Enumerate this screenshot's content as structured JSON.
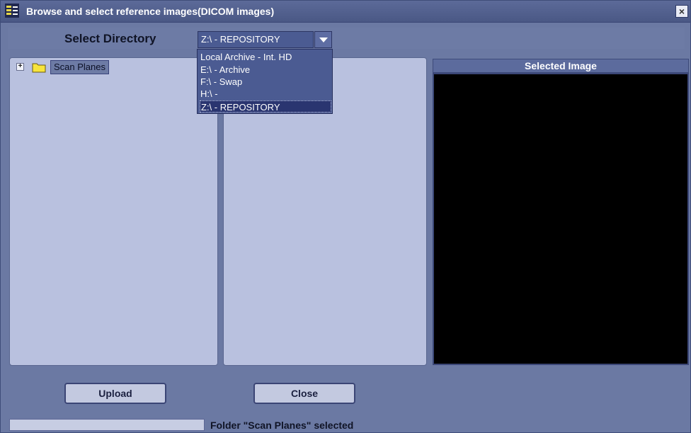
{
  "window": {
    "title": "Browse and select reference images(DICOM images)",
    "close_label": "×"
  },
  "directory": {
    "label": "Select Directory",
    "selected_value": "Z:\\ - REPOSITORY",
    "options": [
      "Local Archive - Int. HD",
      "E:\\ - Archive",
      "F:\\ - Swap",
      "H:\\ -",
      "Z:\\ - REPOSITORY"
    ]
  },
  "tree": {
    "expander_symbol": "+",
    "item_label": "Scan Planes",
    "item_icon": "folder-icon"
  },
  "preview": {
    "header": "Selected Image"
  },
  "buttons": {
    "upload": "Upload",
    "close": "Close"
  },
  "status": {
    "progress": 0,
    "text": "Folder \"Scan Planes\" selected"
  },
  "colors": {
    "window_bg": "#6b79a3",
    "pane_bg": "#b9c1df",
    "selected_dropdown_item": "#2a3570",
    "preview_bg": "#000000"
  }
}
